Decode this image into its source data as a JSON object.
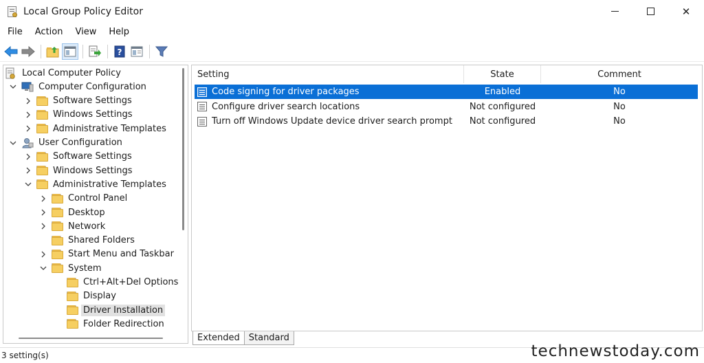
{
  "window": {
    "title": "Local Group Policy Editor",
    "controls": {
      "minimize": "minimize",
      "maximize": "maximize",
      "close": "✕"
    }
  },
  "menu": [
    "File",
    "Action",
    "View",
    "Help"
  ],
  "toolbar": {
    "buttons": [
      "back-arrow-icon",
      "forward-arrow-icon",
      "up-folder-icon",
      "show-hide-tree-icon",
      "export-list-icon",
      "help-icon",
      "properties-icon",
      "filter-icon"
    ]
  },
  "tree": {
    "items": [
      {
        "label": "Local Computer Policy",
        "level": 0,
        "chevron": "none",
        "icon": "policy"
      },
      {
        "label": "Computer Configuration",
        "level": 1,
        "chevron": "down",
        "icon": "computer"
      },
      {
        "label": "Software Settings",
        "level": 2,
        "chevron": "right",
        "icon": "folder"
      },
      {
        "label": "Windows Settings",
        "level": 2,
        "chevron": "right",
        "icon": "folder"
      },
      {
        "label": "Administrative Templates",
        "level": 2,
        "chevron": "right",
        "icon": "folder"
      },
      {
        "label": "User Configuration",
        "level": 1,
        "chevron": "down",
        "icon": "user"
      },
      {
        "label": "Software Settings",
        "level": 2,
        "chevron": "right",
        "icon": "folder"
      },
      {
        "label": "Windows Settings",
        "level": 2,
        "chevron": "right",
        "icon": "folder"
      },
      {
        "label": "Administrative Templates",
        "level": 2,
        "chevron": "down",
        "icon": "folder"
      },
      {
        "label": "Control Panel",
        "level": 3,
        "chevron": "right",
        "icon": "folder"
      },
      {
        "label": "Desktop",
        "level": 3,
        "chevron": "right",
        "icon": "folder"
      },
      {
        "label": "Network",
        "level": 3,
        "chevron": "right",
        "icon": "folder"
      },
      {
        "label": "Shared Folders",
        "level": 3,
        "chevron": "none",
        "icon": "folder"
      },
      {
        "label": "Start Menu and Taskbar",
        "level": 3,
        "chevron": "right",
        "icon": "folder"
      },
      {
        "label": "System",
        "level": 3,
        "chevron": "down",
        "icon": "folder"
      },
      {
        "label": "Ctrl+Alt+Del Options",
        "level": 4,
        "chevron": "none",
        "icon": "folder"
      },
      {
        "label": "Display",
        "level": 4,
        "chevron": "none",
        "icon": "folder"
      },
      {
        "label": "Driver Installation",
        "level": 4,
        "chevron": "none",
        "icon": "folder",
        "selected": true
      },
      {
        "label": "Folder Redirection",
        "level": 4,
        "chevron": "none",
        "icon": "folder"
      }
    ]
  },
  "details": {
    "columns": {
      "setting": "Setting",
      "state": "State",
      "comment": "Comment"
    },
    "rows": [
      {
        "setting": "Code signing for driver packages",
        "state": "Enabled",
        "comment": "No",
        "selected": true
      },
      {
        "setting": "Configure driver search locations",
        "state": "Not configured",
        "comment": "No"
      },
      {
        "setting": "Turn off Windows Update device driver search prompt",
        "state": "Not configured",
        "comment": "No"
      }
    ]
  },
  "tabs": [
    {
      "label": "Extended",
      "active": false
    },
    {
      "label": "Standard",
      "active": true
    }
  ],
  "status": {
    "text": "3 setting(s)"
  },
  "watermark": "technewstoday.com",
  "colors": {
    "selection": "#0a6fd6",
    "tree_selection": "#e1e1e1",
    "folder": "#f6cf62"
  }
}
